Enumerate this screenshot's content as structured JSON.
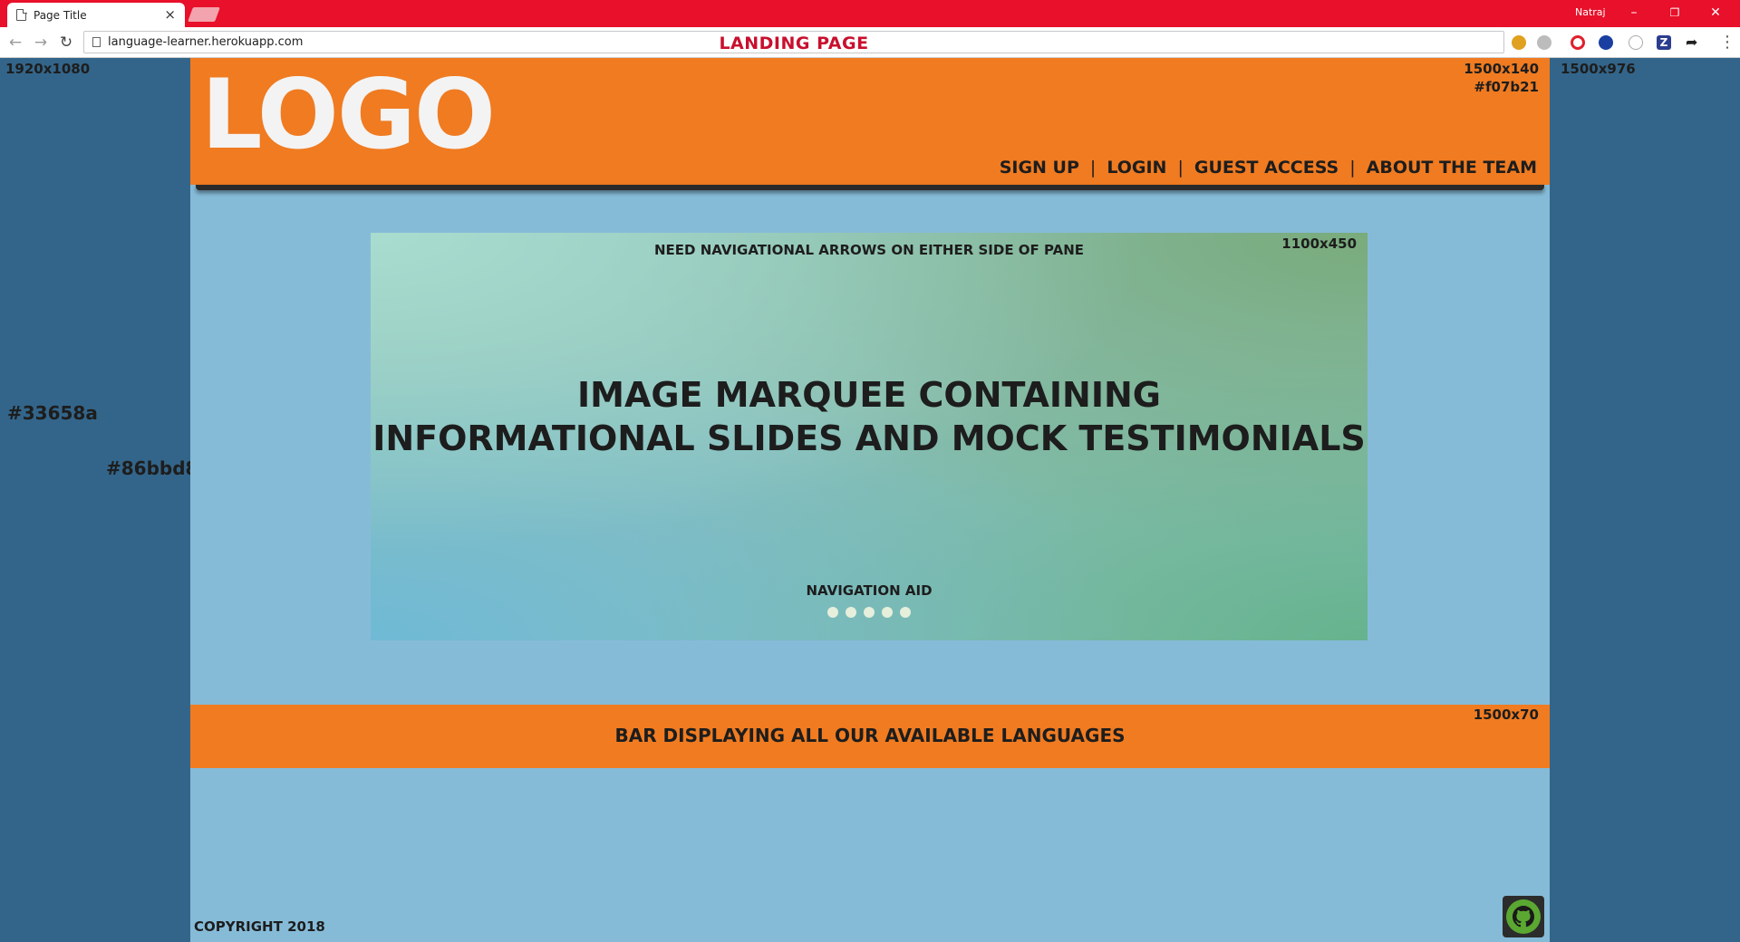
{
  "browser": {
    "tab_title": "Page Title",
    "tab_close": "×",
    "profile_name": "Natraj",
    "url": "language-learner.herokuapp.com",
    "page_label": "LANDING PAGE",
    "window_controls": {
      "minimize": "–",
      "restore": "❐",
      "close": "✕"
    }
  },
  "notes": {
    "viewport_size": "1920x1080",
    "content_size": "1500x976",
    "outer_color": "#33658a",
    "inner_color": "#86bbd8"
  },
  "header": {
    "logo": "LOGO",
    "size": "1500x140",
    "color": "#f07b21",
    "nav": [
      "SIGN UP",
      "LOGIN",
      "GUEST ACCESS",
      "ABOUT THE TEAM"
    ]
  },
  "marquee": {
    "note": "NEED NAVIGATIONAL ARROWS ON EITHER SIDE OF PANE",
    "size": "1100x450",
    "title_line1": "IMAGE MARQUEE CONTAINING",
    "title_line2": "INFORMATIONAL SLIDES AND MOCK TESTIMONIALS",
    "nav_aid": "NAVIGATION AID",
    "dot_count": 5
  },
  "languages_bar": {
    "label": "BAR DISPLAYING ALL OUR AVAILABLE LANGUAGES",
    "size": "1500x70"
  },
  "footer": {
    "copyright": "COPYRIGHT 2018",
    "github_icon": "github-icon"
  },
  "colors": {
    "titlebar": "#e8102a",
    "page_label": "#c8102e",
    "orange": "#f07b21",
    "light_blue": "#86bbd8",
    "dark_blue": "#33658a"
  }
}
